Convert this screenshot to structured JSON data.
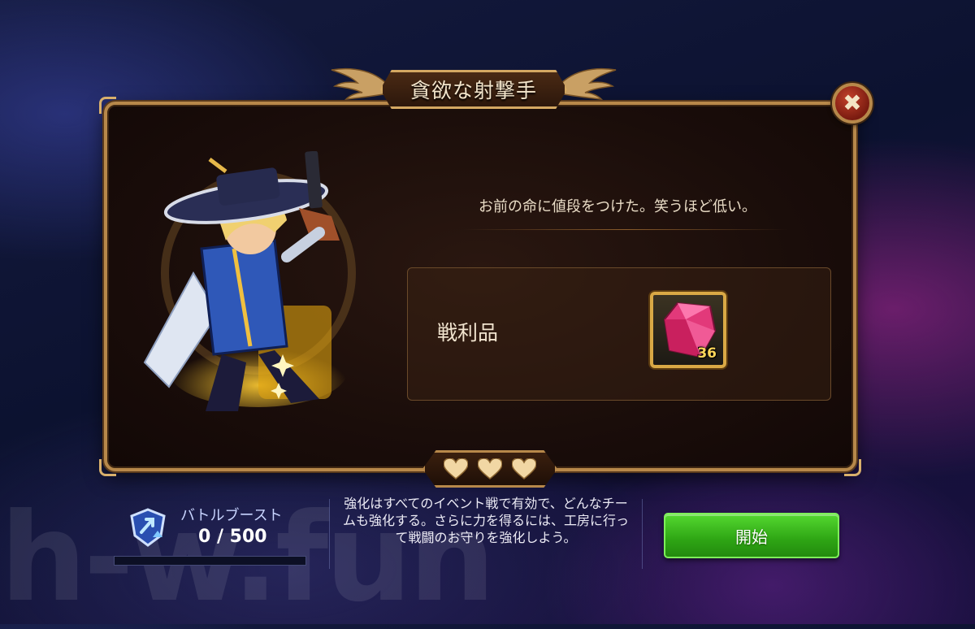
{
  "dialog": {
    "title": "貪欲な射撃手",
    "close_icon": "close-icon",
    "quote": "お前の命に値段をつけた。笑うほど低い。",
    "loot": {
      "label": "戦利品",
      "item": {
        "icon": "pink-crystal-icon",
        "count": "36"
      }
    },
    "hearts": {
      "count": 3,
      "icon": "heart-icon"
    }
  },
  "footer": {
    "boost": {
      "icon": "battle-boost-icon",
      "label": "バトルブースト",
      "value": "0 / 500",
      "progress": 0
    },
    "info": "強化はすべてのイベント戦で有効で、どんなチームも強化する。さらに力を得るには、工房に行って戦闘のお守りを強化しよう。",
    "start_label": "開始"
  },
  "watermark": "h-w.fun",
  "colors": {
    "frame": "#b7884a",
    "start_button": "#3cc11e",
    "item_count": "#ffd75a"
  }
}
